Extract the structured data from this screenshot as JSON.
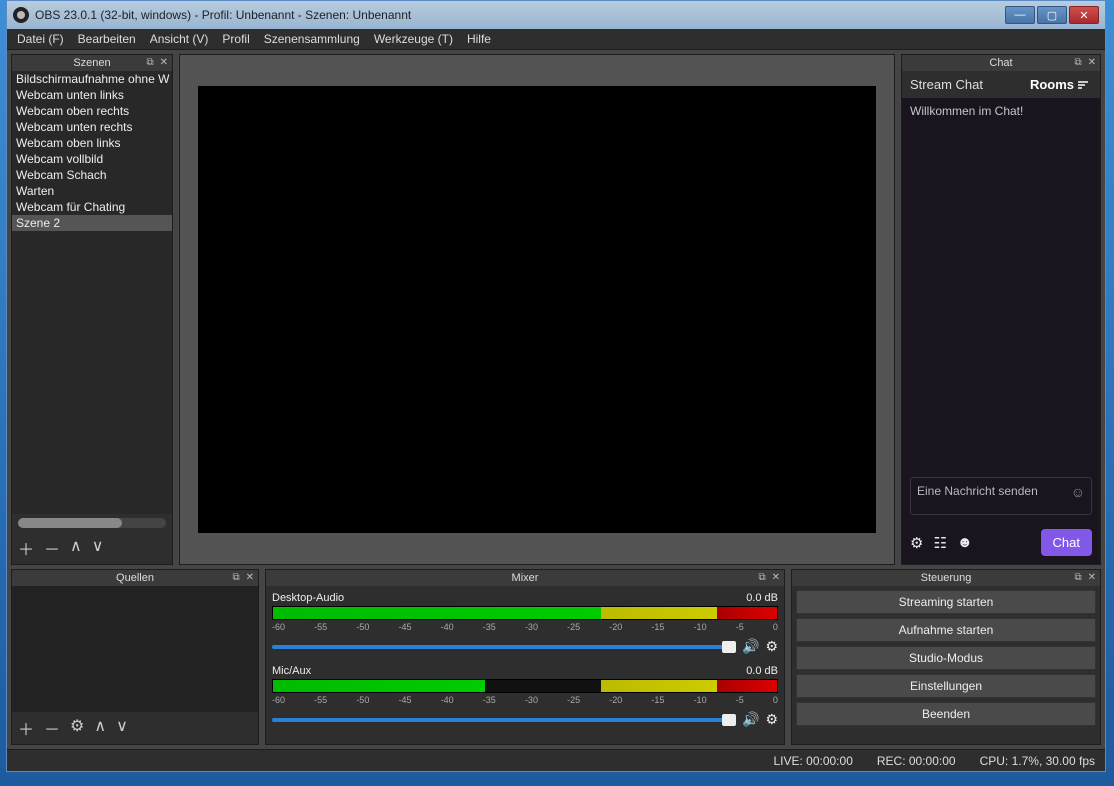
{
  "window_title": "OBS 23.0.1 (32-bit, windows) - Profil: Unbenannt - Szenen: Unbenannt",
  "menu": {
    "file": "Datei (F)",
    "edit": "Bearbeiten",
    "view": "Ansicht (V)",
    "profile": "Profil",
    "scenecoll": "Szenensammlung",
    "tools": "Werkzeuge (T)",
    "help": "Hilfe"
  },
  "scenes": {
    "title": "Szenen",
    "items": [
      "Bildschirmaufnahme ohne W",
      "Webcam unten links",
      "Webcam oben rechts",
      "Webcam unten rechts",
      "Webcam oben links",
      "Webcam vollbild",
      "Webcam Schach",
      "Warten",
      "Webcam für Chating",
      "Szene 2"
    ],
    "selected_index": 9
  },
  "sources": {
    "title": "Quellen"
  },
  "mixer": {
    "title": "Mixer",
    "tracks": [
      {
        "name": "Desktop-Audio",
        "db": "0.0 dB",
        "ticks": [
          "-60",
          "-55",
          "-50",
          "-45",
          "-40",
          "-35",
          "-30",
          "-25",
          "-20",
          "-15",
          "-10",
          "-5",
          "0"
        ],
        "g_w": "65%",
        "y_l": "65%",
        "y_w": "23%",
        "r_w": "12%"
      },
      {
        "name": "Mic/Aux",
        "db": "0.0 dB",
        "ticks": [
          "-60",
          "-55",
          "-50",
          "-45",
          "-40",
          "-35",
          "-30",
          "-25",
          "-20",
          "-15",
          "-10",
          "-5",
          "0"
        ],
        "g_w": "42%",
        "y_l": "65%",
        "y_w": "23%",
        "r_w": "12%"
      }
    ]
  },
  "controls": {
    "title": "Steuerung",
    "buttons": [
      "Streaming starten",
      "Aufnahme starten",
      "Studio-Modus",
      "Einstellungen",
      "Beenden"
    ]
  },
  "chat": {
    "title": "Chat",
    "stream_tab": "Stream Chat",
    "rooms": "Rooms",
    "welcome": "Willkommen im Chat!",
    "placeholder": "Eine Nachricht senden",
    "send": "Chat"
  },
  "status": {
    "live": "LIVE: 00:00:00",
    "rec": "REC: 00:00:00",
    "cpu": "CPU: 1.7%, 30.00 fps"
  }
}
